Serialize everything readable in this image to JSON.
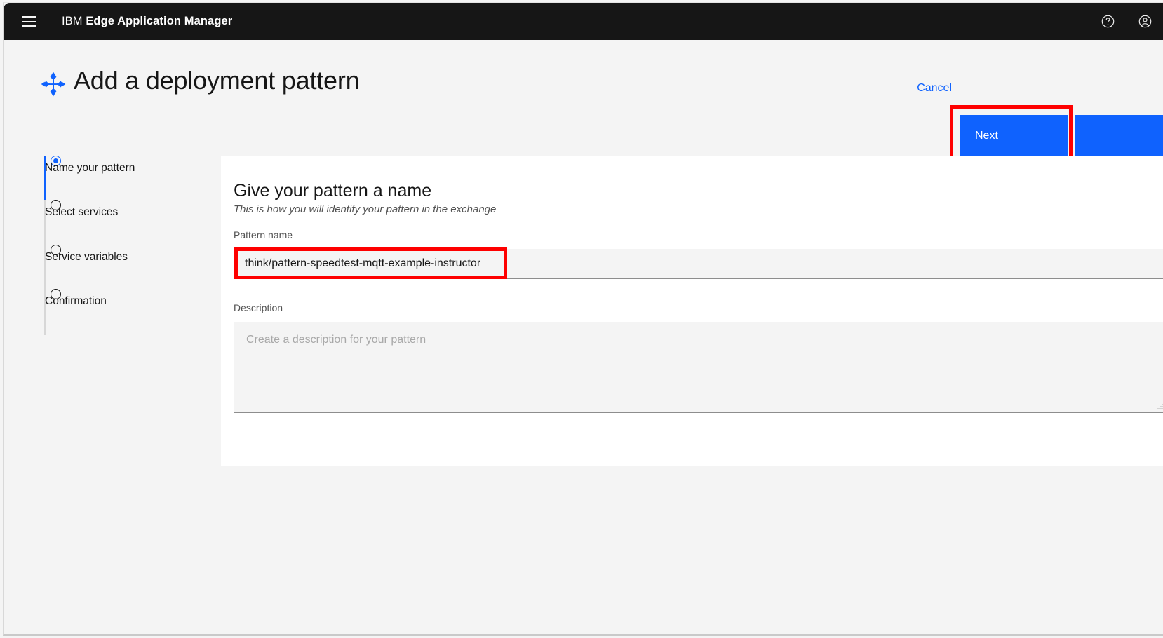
{
  "navbar": {
    "menu_icon": "hamburger-menu-icon",
    "brand_prefix": "IBM",
    "brand_name": "Edge Application Manager",
    "help_icon": "help-circle-icon",
    "account_icon": "user-avatar-icon"
  },
  "page": {
    "title": "Add a deployment pattern",
    "title_icon": "deployment-pattern-icon",
    "cancel_label": "Cancel",
    "next_label": "Next"
  },
  "progress": {
    "steps": [
      {
        "label": "Name your pattern",
        "state": "active"
      },
      {
        "label": "Select services",
        "state": "incomplete"
      },
      {
        "label": "Service variables",
        "state": "incomplete"
      },
      {
        "label": "Confirmation",
        "state": "incomplete"
      }
    ]
  },
  "form": {
    "heading": "Give your pattern a name",
    "subheading": "This is how you will identify your pattern in the exchange",
    "pattern_label": "Pattern name",
    "pattern_value": "think/pattern-speedtest-mqtt-example-instructor",
    "pattern_placeholder": "Pattern name",
    "description_label": "Description",
    "description_value": "",
    "description_placeholder": "Create a description for your pattern"
  },
  "annotations": [
    {
      "name": "next-button-highlight",
      "color": "#fe0000"
    },
    {
      "name": "pattern-name-input-highlight",
      "color": "#fe0000"
    }
  ],
  "colors": {
    "brand_blue": "#0f62fe",
    "navbar_bg": "#161616",
    "page_bg": "#f4f4f4",
    "card_bg": "#ffffff",
    "annotation_red": "#fe0000"
  }
}
